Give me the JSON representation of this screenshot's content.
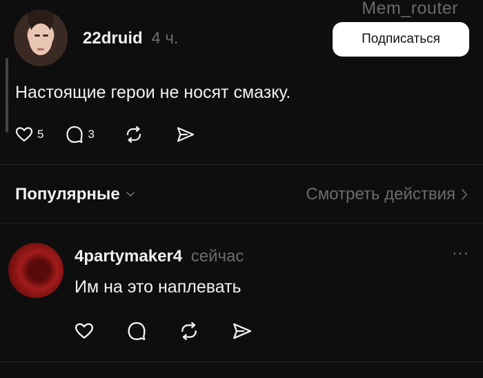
{
  "watermark": "Mem_router",
  "post": {
    "username": "22druid",
    "time": "4 ч.",
    "text": "Настоящие герои не носят смазку.",
    "likes": "5",
    "comments": "3",
    "follow_label": "Подписаться"
  },
  "replies_header": {
    "sort_label": "Популярные",
    "view_activity_label": "Смотреть действия"
  },
  "reply": {
    "username": "4partymaker4",
    "time": "сейчас",
    "text": "Им на это наплевать",
    "more": "···"
  },
  "icons": {
    "like": "heart-icon",
    "comment": "comment-bubble-icon",
    "repost": "repost-icon",
    "share": "send-icon",
    "chevron": "chevron-icon"
  }
}
